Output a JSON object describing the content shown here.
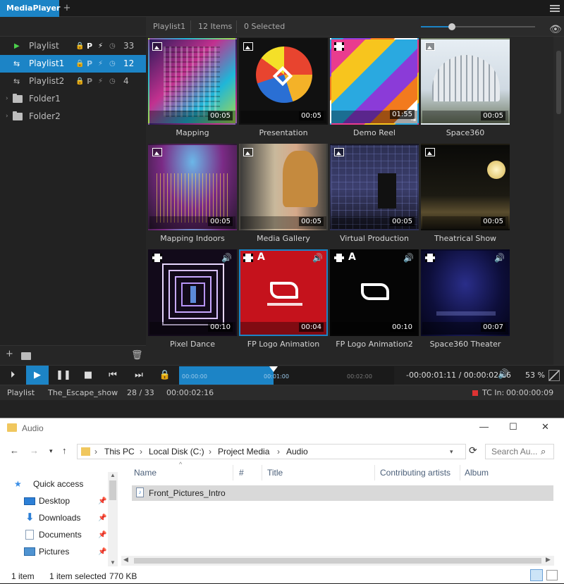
{
  "mediaplayer": {
    "tab_title": "MediaPlayer",
    "tab_add": "+",
    "playlists": [
      {
        "label": "Playlist",
        "lock": "🔒",
        "p": "P",
        "count": "33"
      },
      {
        "label": "Playlist1",
        "lock": "🔒",
        "p": "P",
        "count": "12"
      },
      {
        "label": "Playlist2",
        "lock": "🔒",
        "p": "P",
        "count": "4"
      }
    ],
    "folders": [
      {
        "label": "Folder1"
      },
      {
        "label": "Folder2"
      }
    ],
    "sidebar_add": "+",
    "grid_header": {
      "playlist": "Playlist1",
      "items": "12 Items",
      "selected": "0 Selected",
      "thumb_size": 0.27
    },
    "tiles": [
      {
        "name": "Mapping",
        "duration": "00:05",
        "type": "image"
      },
      {
        "name": "Presentation",
        "duration": "00:05",
        "type": "image"
      },
      {
        "name": "Demo Reel",
        "duration": "01:55",
        "type": "video"
      },
      {
        "name": "Space360",
        "duration": "00:05",
        "type": "image"
      },
      {
        "name": "Mapping Indoors",
        "duration": "00:05",
        "type": "image"
      },
      {
        "name": "Media Gallery",
        "duration": "00:05",
        "type": "image"
      },
      {
        "name": "Virtual Production",
        "duration": "00:05",
        "type": "image"
      },
      {
        "name": "Theatrical Show",
        "duration": "00:05",
        "type": "image"
      },
      {
        "name": "Pixel Dance",
        "duration": "00:10",
        "type": "video"
      },
      {
        "name": "FP Logo Animation",
        "duration": "00:04",
        "type": "video",
        "alpha": "A"
      },
      {
        "name": "FP Logo Animation2",
        "duration": "00:10",
        "type": "video",
        "alpha": "A"
      },
      {
        "name": "Space360 Theater",
        "duration": "00:07",
        "type": "video"
      }
    ],
    "transport": {
      "tick1": "00:00:00",
      "tick2": "00:01:00",
      "tick3": "00:02:00",
      "time_readout": "-00:00:01:11 / 00:00:02:16",
      "volume": "53 %",
      "progress": 0.44
    },
    "status": {
      "playlist_label": "Playlist",
      "show": "The_Escape_show",
      "position": "28 / 33",
      "duration": "00:00:02:16",
      "tc_label": "TC In:",
      "tc_value": "00:00:00:09"
    }
  },
  "explorer": {
    "title": "Audio",
    "breadcrumb": [
      "This PC",
      "Local Disk (C:)",
      "Project Media",
      "Audio"
    ],
    "search_placeholder": "Search Au...",
    "nav": [
      {
        "label": "Quick access"
      },
      {
        "label": "Desktop"
      },
      {
        "label": "Downloads"
      },
      {
        "label": "Documents"
      },
      {
        "label": "Pictures"
      }
    ],
    "columns": [
      "Name",
      "#",
      "Title",
      "Contributing artists",
      "Album"
    ],
    "files": [
      {
        "name": "Front_Pictures_Intro"
      }
    ],
    "status_items": "1 item",
    "status_selected": "1 item selected",
    "status_size": "770 KB",
    "colors": {
      "accent": "#1c84c6",
      "folder": "#f0c75e"
    }
  }
}
